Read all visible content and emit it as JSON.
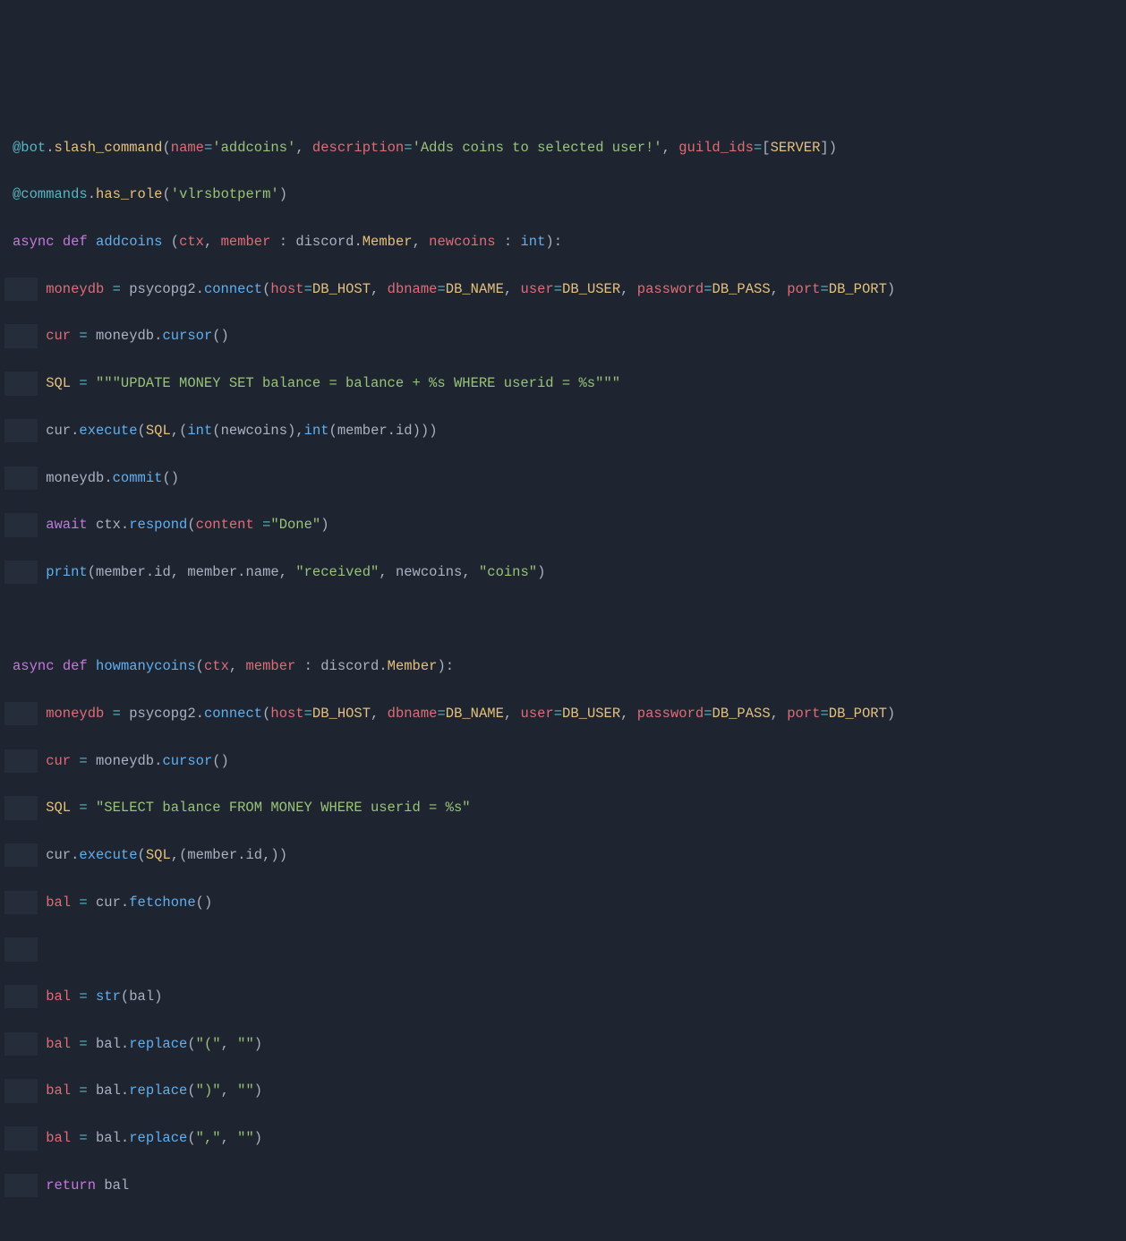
{
  "lines": {
    "l1": {
      "deco_at": "@bot",
      "deco_dot": ".",
      "deco_fn": "slash_command",
      "p_open": "(",
      "arg_name_k": "name",
      "eq1": "=",
      "str_name": "'addcoins'",
      "comma1": ", ",
      "arg_desc_k": "description",
      "eq2": "=",
      "str_desc": "'Adds coins to selected user!'",
      "comma2": ", ",
      "arg_gids_k": "guild_ids",
      "eq3": "=",
      "br_open": "[",
      "server_const": "SERVER",
      "br_close": "]",
      "p_close": ")"
    },
    "l2": {
      "deco_at": "@commands",
      "deco_dot": ".",
      "deco_fn": "has_role",
      "p_open": "(",
      "str_role": "'vlrsbotperm'",
      "p_close": ")"
    },
    "l3": {
      "kw_async": "async",
      "kw_def": "def",
      "fn_name": "addcoins",
      "p_open": " (",
      "p_ctx": "ctx",
      "c1": ", ",
      "p_member": "member",
      "colon1": " : ",
      "t_discord": "discord",
      "dot1": ".",
      "t_member": "Member",
      "c2": ", ",
      "p_newcoins": "newcoins",
      "colon2": " : ",
      "t_int": "int",
      "p_close": "):"
    },
    "l4": {
      "v_moneydb": "moneydb",
      "eq": " = ",
      "mod": "psycopg2",
      "dot": ".",
      "fn_conn": "connect",
      "p_open": "(",
      "k_host": "host",
      "eq1": "=",
      "c_host": "DB_HOST",
      "cm1": ", ",
      "k_db": "dbname",
      "eq2": "=",
      "c_db": "DB_NAME",
      "cm2": ", ",
      "k_user": "user",
      "eq3": "=",
      "c_user": "DB_USER",
      "cm3": ", ",
      "k_pw": "password",
      "eq4": "=",
      "c_pw": "DB_PASS",
      "cm4": ", ",
      "k_port": "port",
      "eq5": "=",
      "c_port": "DB_PORT",
      "p_close": ")"
    },
    "l5": {
      "v_cur": "cur",
      "eq": " = ",
      "v_mdb": "moneydb",
      "dot": ".",
      "fn_cursor": "cursor",
      "parens": "()"
    },
    "l6": {
      "v_sql": "SQL",
      "eq": " = ",
      "str_sql": "\"\"\"UPDATE MONEY SET balance = balance + %s WHERE userid = %s\"\"\""
    },
    "l7": {
      "v_cur": "cur",
      "dot": ".",
      "fn_exec": "execute",
      "p_open": "(",
      "v_sql": "SQL",
      "cm1": ",",
      "t_open": "(",
      "fn_int1": "int",
      "ip1o": "(",
      "v_nc": "newcoins",
      "ip1c": ")",
      "cm2": ",",
      "fn_int2": "int",
      "ip2o": "(",
      "v_mem": "member",
      "dot2": ".",
      "v_id": "id",
      "ip2c": ")",
      "t_close": ")",
      "p_close": ")"
    },
    "l8": {
      "v_mdb": "moneydb",
      "dot": ".",
      "fn_commit": "commit",
      "parens": "()"
    },
    "l9": {
      "kw_await": "await",
      "sp": " ",
      "v_ctx": "ctx",
      "dot": ".",
      "fn_respond": "respond",
      "p_open": "(",
      "k_content": "content",
      "eq": " =",
      "str_done": "\"Done\"",
      "p_close": ")"
    },
    "l10": {
      "fn_print": "print",
      "p_open": "(",
      "v_mem": "member",
      "dot1": ".",
      "v_id": "id",
      "cm1": ", ",
      "v_mem2": "member",
      "dot2": ".",
      "v_name": "name",
      "cm2": ", ",
      "str_recv": "\"received\"",
      "cm3": ", ",
      "v_nc": "newcoins",
      "cm4": ", ",
      "str_coins": "\"coins\"",
      "p_close": ")"
    },
    "l12": {
      "kw_async": "async",
      "kw_def": "def",
      "fn_name": "howmanycoins",
      "p_open": "(",
      "p_ctx": "ctx",
      "c1": ", ",
      "p_member": "member",
      "colon1": " : ",
      "t_discord": "discord",
      "dot1": ".",
      "t_member": "Member",
      "p_close": "):"
    },
    "l13": {
      "v_moneydb": "moneydb",
      "eq": " = ",
      "mod": "psycopg2",
      "dot": ".",
      "fn_conn": "connect",
      "p_open": "(",
      "k_host": "host",
      "eq1": "=",
      "c_host": "DB_HOST",
      "cm1": ", ",
      "k_db": "dbname",
      "eq2": "=",
      "c_db": "DB_NAME",
      "cm2": ", ",
      "k_user": "user",
      "eq3": "=",
      "c_user": "DB_USER",
      "cm3": ", ",
      "k_pw": "password",
      "eq4": "=",
      "c_pw": "DB_PASS",
      "cm4": ", ",
      "k_port": "port",
      "eq5": "=",
      "c_port": "DB_PORT",
      "p_close": ")"
    },
    "l14": {
      "v_cur": "cur",
      "eq": " = ",
      "v_mdb": "moneydb",
      "dot": ".",
      "fn_cursor": "cursor",
      "parens": "()"
    },
    "l15": {
      "v_sql": "SQL",
      "eq": " = ",
      "str_sql": "\"SELECT balance FROM MONEY WHERE userid = %s\""
    },
    "l16": {
      "v_cur": "cur",
      "dot": ".",
      "fn_exec": "execute",
      "p_open": "(",
      "v_sql": "SQL",
      "cm1": ",",
      "t_open": "(",
      "v_mem": "member",
      "dot2": ".",
      "v_id": "id",
      "cm2": ",",
      "t_close": ")",
      "p_close": ")"
    },
    "l17": {
      "v_bal": "bal",
      "eq": " = ",
      "v_cur": "cur",
      "dot": ".",
      "fn_fetch": "fetchone",
      "parens": "()"
    },
    "l19": {
      "v_bal": "bal",
      "eq": " = ",
      "fn_str": "str",
      "p_open": "(",
      "v_bal2": "bal",
      "p_close": ")"
    },
    "l20": {
      "v_bal": "bal",
      "eq": " = ",
      "v_bal2": "bal",
      "dot": ".",
      "fn_rep": "replace",
      "p_open": "(",
      "s1": "\"(\"",
      "cm": ", ",
      "s2": "\"\"",
      "p_close": ")"
    },
    "l21": {
      "v_bal": "bal",
      "eq": " = ",
      "v_bal2": "bal",
      "dot": ".",
      "fn_rep": "replace",
      "p_open": "(",
      "s1": "\")\"",
      "cm": ", ",
      "s2": "\"\"",
      "p_close": ")"
    },
    "l22": {
      "v_bal": "bal",
      "eq": " = ",
      "v_bal2": "bal",
      "dot": ".",
      "fn_rep": "replace",
      "p_open": "(",
      "s1": "\",\"",
      "cm": ", ",
      "s2": "\"\"",
      "p_close": ")"
    },
    "l23": {
      "kw_return": "return",
      "sp": " ",
      "v_bal": "bal"
    }
  }
}
